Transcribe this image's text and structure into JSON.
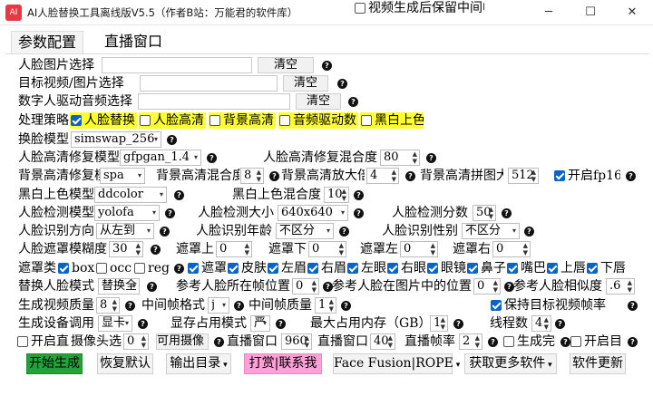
{
  "window": {
    "app_icon_text": "AI",
    "title": "AI人脸替换工具离线版V5.5（作者B站：万能君的软件库）",
    "minimize": "─",
    "maximize": "☐",
    "close": "✕"
  },
  "tabs": [
    {
      "label": "参数配置"
    },
    {
      "label": "直播窗口"
    }
  ],
  "file_rows": {
    "face_image": {
      "label": "人脸图片选择",
      "clear": "清空"
    },
    "target_video": {
      "label": "目标视频/图片选择",
      "clear": "清空"
    },
    "digital_audio": {
      "label": "数字人驱动音频选择",
      "clear": "清空"
    }
  },
  "strategy": {
    "label": "处理策略",
    "options": [
      {
        "label": "人脸替换",
        "checked": true,
        "highlight": true
      },
      {
        "label": "人脸高清",
        "checked": false,
        "highlight": true
      },
      {
        "label": "背景高清",
        "checked": false,
        "highlight": true
      },
      {
        "label": "音频驱动数",
        "checked": false,
        "highlight": true
      },
      {
        "label": "黑白上色",
        "checked": false,
        "highlight": true
      }
    ]
  },
  "swap_model": {
    "label": "换脸模型",
    "value": "simswap_256"
  },
  "face_enhance": {
    "label": "人脸高清修复模型",
    "value": "gfpgan_1.4",
    "blend_label": "人脸高清修复混合度",
    "blend_value": "80"
  },
  "bg_enhance": {
    "label": "背景高清修复模",
    "value": "spa",
    "blend_label": "背景高清混合度",
    "blend_value": "8",
    "scale_label": "背景高清放大倍",
    "scale_value": "4",
    "tile_label": "背景高清拼图大",
    "tile_value": "512",
    "fp16_label": "开启fp16",
    "fp16_checked": true
  },
  "colorize": {
    "label": "黑白上色模型",
    "value": "ddcolor",
    "blend_label": "黑白上色混合度",
    "blend_value": "10"
  },
  "detect": {
    "label": "人脸检测模型",
    "value": "yolofa",
    "size_label": "人脸检测大小",
    "size_value": "640x640",
    "score_label": "人脸检测分数",
    "score_value": "50"
  },
  "recog": {
    "dir_label": "人脸识别方向",
    "dir_value": "从左到",
    "age_label": "人脸识别年龄",
    "age_value": "不区分",
    "gender_label": "人脸识别性别",
    "gender_value": "不区分"
  },
  "mask_blur": {
    "label": "人脸遮罩模糊度",
    "value": "30",
    "top_label": "遮罩上",
    "top_value": "0",
    "bottom_label": "遮罩下",
    "bottom_value": "0",
    "left_label": "遮罩左",
    "left_value": "0",
    "right_label": "遮罩右",
    "right_value": "0"
  },
  "mask_types": {
    "label": "遮罩类",
    "options": [
      {
        "label": "box",
        "checked": true
      },
      {
        "label": "occ",
        "checked": false
      },
      {
        "label": "reg",
        "checked": false
      },
      {
        "label": "遮罩区",
        "checked": true
      },
      {
        "label": "皮肤",
        "checked": true
      },
      {
        "label": "左眉",
        "checked": true
      },
      {
        "label": "右眉",
        "checked": true
      },
      {
        "label": "左眼",
        "checked": true
      },
      {
        "label": "右眼",
        "checked": true
      },
      {
        "label": "眼镜",
        "checked": true
      },
      {
        "label": "鼻子",
        "checked": true
      },
      {
        "label": "嘴巴",
        "checked": true
      },
      {
        "label": "上唇",
        "checked": true
      },
      {
        "label": "下唇",
        "checked": true
      }
    ]
  },
  "replace_mode": {
    "label": "替换人脸模式",
    "value": "替换全",
    "pos_label": "参考人脸所在帧位置",
    "pos_value": "0",
    "img_pos_label": "参考人脸在图片中的位置",
    "img_pos_value": "0",
    "sim_label": "参考人脸相似度",
    "sim_value": ".6"
  },
  "output_quality": {
    "label": "生成视频质量",
    "value": "8",
    "fmt_label": "中间帧格式",
    "fmt_value": "j",
    "q_label": "中间帧质量",
    "q_value": "1",
    "keep_label": "视频生成后保留中间帧",
    "keep_checked": false,
    "fps_label": "保持目标视频帧率",
    "fps_checked": true
  },
  "device": {
    "label": "生成设备调用",
    "value": "显卡",
    "vram_label": "显存占用模式",
    "vram_value": "严",
    "mem_label": "最大占用内存（GB）",
    "mem_value": "1",
    "thread_label": "线程数",
    "thread_value": "4"
  },
  "live": {
    "open_label": "开启直",
    "cam_label": "摄像头选",
    "cam_value": "0",
    "avail_label": "可用摄像",
    "win1_label": "直播窗口",
    "win1_value": "960",
    "win2_label": "直播窗口",
    "win2_value": "40",
    "fps_label": "直播帧率",
    "fps_value": "2",
    "done_label": "生成完",
    "open2_label": "开启目"
  },
  "actions": {
    "start": "开始生成",
    "restore": "恢复默认",
    "output_dir": "输出目录",
    "reward": "打赏|联系我",
    "facefusion": "Face Fusion|ROPE",
    "more": "获取更多软件",
    "update": "软件更新"
  },
  "colors": {
    "start_bg": "#22a33a",
    "reward_bg": "#ffa0d8",
    "highlight": "#ffff33",
    "check_blue": "#0a64c8"
  }
}
